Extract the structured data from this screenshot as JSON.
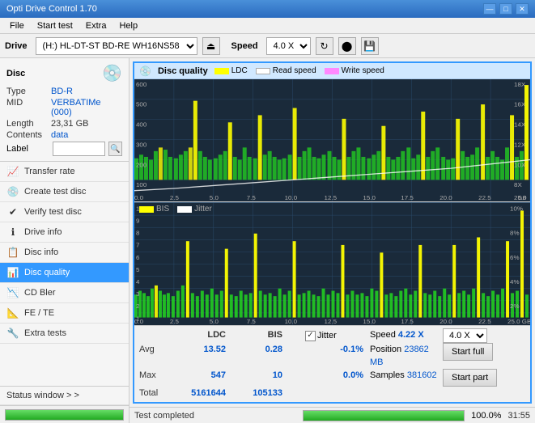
{
  "app": {
    "title": "Opti Drive Control 1.70",
    "title_icon": "💿"
  },
  "titlebar": {
    "minimize": "—",
    "maximize": "□",
    "close": "✕"
  },
  "menu": {
    "items": [
      "File",
      "Start test",
      "Extra",
      "Help"
    ]
  },
  "drive_bar": {
    "label": "Drive",
    "drive_value": "(H:) HL-DT-ST BD-RE  WH16NS58 TST4",
    "eject_icon": "⏏",
    "speed_label": "Speed",
    "speed_value": "4.0 X",
    "toolbar_icons": [
      "↻",
      "⬤",
      "💾"
    ]
  },
  "disc": {
    "title": "Disc",
    "type_label": "Type",
    "type_value": "BD-R",
    "mid_label": "MID",
    "mid_value": "VERBATIMe (000)",
    "length_label": "Length",
    "length_value": "23,31 GB",
    "contents_label": "Contents",
    "contents_value": "data",
    "label_label": "Label",
    "label_value": ""
  },
  "nav": {
    "items": [
      {
        "id": "transfer-rate",
        "label": "Transfer rate",
        "icon": "📈"
      },
      {
        "id": "create-test-disc",
        "label": "Create test disc",
        "icon": "💿"
      },
      {
        "id": "verify-test-disc",
        "label": "Verify test disc",
        "icon": "✔"
      },
      {
        "id": "drive-info",
        "label": "Drive info",
        "icon": "ℹ"
      },
      {
        "id": "disc-info",
        "label": "Disc info",
        "icon": "📋"
      },
      {
        "id": "disc-quality",
        "label": "Disc quality",
        "icon": "📊",
        "active": true
      },
      {
        "id": "cd-bler",
        "label": "CD Bler",
        "icon": "📉"
      },
      {
        "id": "fe-te",
        "label": "FE / TE",
        "icon": "📐"
      },
      {
        "id": "extra-tests",
        "label": "Extra tests",
        "icon": "🔧"
      }
    ]
  },
  "status_window": {
    "label": "Status window > >"
  },
  "chart": {
    "title": "Disc quality",
    "legend": [
      {
        "label": "LDC",
        "color": "#ffff00"
      },
      {
        "label": "Read speed",
        "color": "#ffffff"
      },
      {
        "label": "Write speed",
        "color": "#ff66ff"
      }
    ],
    "legend2": [
      {
        "label": "BIS",
        "color": "#ffff00"
      },
      {
        "label": "Jitter",
        "color": "#ffffff"
      }
    ],
    "x_max": "25.0",
    "x_unit": "GB"
  },
  "stats": {
    "headers": [
      "",
      "LDC",
      "BIS",
      "",
      "Jitter",
      "Speed",
      ""
    ],
    "avg_label": "Avg",
    "avg_ldc": "13.52",
    "avg_bis": "0.28",
    "avg_jitter": "-0.1%",
    "max_label": "Max",
    "max_ldc": "547",
    "max_bis": "10",
    "max_jitter": "0.0%",
    "total_label": "Total",
    "total_ldc": "5161644",
    "total_bis": "105133",
    "jitter_label": "Jitter",
    "jitter_checked": true,
    "speed_label": "Speed",
    "speed_value": "4.22 X",
    "speed_select": "4.0 X",
    "position_label": "Position",
    "position_value": "23862 MB",
    "samples_label": "Samples",
    "samples_value": "381602",
    "btn_full": "Start full",
    "btn_part": "Start part"
  },
  "progress": {
    "value": 100,
    "label": "100.0%",
    "status": "Test completed",
    "time": "31:55"
  }
}
